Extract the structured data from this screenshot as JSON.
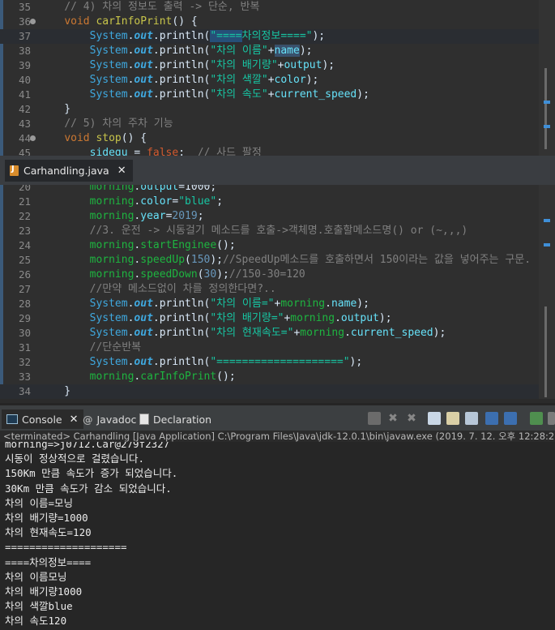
{
  "editor_top": {
    "lines": [
      {
        "n": "35",
        "segs": [
          [
            "    ",
            "t-plain"
          ],
          [
            "// 4) 차의 정보도 출력 -> 단순, 반복",
            "t-cmt"
          ]
        ]
      },
      {
        "n": "36",
        "fold": true,
        "segs": [
          [
            "    ",
            "t-plain"
          ],
          [
            "void",
            "t-kw"
          ],
          [
            " ",
            "t-plain"
          ],
          [
            "carInfoPrint",
            "t-fn"
          ],
          [
            "() {",
            "t-plain"
          ]
        ]
      },
      {
        "n": "37",
        "hl": true,
        "segs": [
          [
            "        ",
            "t-plain"
          ],
          [
            "System",
            "t-cls"
          ],
          [
            ".",
            "t-plain"
          ],
          [
            "out",
            "t-field"
          ],
          [
            ".println(",
            "t-plain"
          ],
          [
            "\"====",
            "t-str sel"
          ],
          [
            "차의정보====\"",
            "t-str"
          ],
          [
            ");",
            "t-plain"
          ]
        ]
      },
      {
        "n": "38",
        "segs": [
          [
            "        ",
            "t-plain"
          ],
          [
            "System",
            "t-cls"
          ],
          [
            ".",
            "t-plain"
          ],
          [
            "out",
            "t-field"
          ],
          [
            ".println(",
            "t-plain"
          ],
          [
            "\"차의 이름\"",
            "t-str"
          ],
          [
            "+",
            "t-plain"
          ],
          [
            "name",
            "t-var selw"
          ],
          [
            ");",
            "t-plain"
          ]
        ]
      },
      {
        "n": "39",
        "segs": [
          [
            "        ",
            "t-plain"
          ],
          [
            "System",
            "t-cls"
          ],
          [
            ".",
            "t-plain"
          ],
          [
            "out",
            "t-field"
          ],
          [
            ".println(",
            "t-plain"
          ],
          [
            "\"차의 배기량\"",
            "t-str"
          ],
          [
            "+",
            "t-plain"
          ],
          [
            "output",
            "t-var"
          ],
          [
            ");",
            "t-plain"
          ]
        ]
      },
      {
        "n": "40",
        "segs": [
          [
            "        ",
            "t-plain"
          ],
          [
            "System",
            "t-cls"
          ],
          [
            ".",
            "t-plain"
          ],
          [
            "out",
            "t-field"
          ],
          [
            ".println(",
            "t-plain"
          ],
          [
            "\"차의 색깔\"",
            "t-str"
          ],
          [
            "+",
            "t-plain"
          ],
          [
            "color",
            "t-var"
          ],
          [
            ");",
            "t-plain"
          ]
        ]
      },
      {
        "n": "41",
        "segs": [
          [
            "        ",
            "t-plain"
          ],
          [
            "System",
            "t-cls"
          ],
          [
            ".",
            "t-plain"
          ],
          [
            "out",
            "t-field"
          ],
          [
            ".println(",
            "t-plain"
          ],
          [
            "\"차의 속도\"",
            "t-str"
          ],
          [
            "+",
            "t-plain"
          ],
          [
            "current_speed",
            "t-var"
          ],
          [
            ");",
            "t-plain"
          ]
        ]
      },
      {
        "n": "42",
        "segs": [
          [
            "    }",
            "t-plain"
          ]
        ]
      },
      {
        "n": "43",
        "segs": [
          [
            "    ",
            "t-plain"
          ],
          [
            "// 5) 차의 주차 기능",
            "t-cmt"
          ]
        ]
      },
      {
        "n": "44",
        "fold": true,
        "segs": [
          [
            "    ",
            "t-plain"
          ],
          [
            "void",
            "t-kw"
          ],
          [
            " ",
            "t-plain"
          ],
          [
            "stop",
            "t-fn"
          ],
          [
            "() {",
            "t-plain"
          ]
        ]
      },
      {
        "n": "45",
        "segs": [
          [
            "        ",
            "t-plain"
          ],
          [
            "sidegu",
            "t-var"
          ],
          [
            " = ",
            "t-plain"
          ],
          [
            "false",
            "t-kwp"
          ],
          [
            ";  ",
            "t-plain"
          ],
          [
            "// 사드 팔정",
            "t-cmt"
          ]
        ]
      }
    ]
  },
  "tab": {
    "label": "Carhandling.java"
  },
  "editor_bottom": {
    "lines": [
      {
        "n": "20",
        "segs": [
          [
            "        ",
            "t-plain"
          ],
          [
            "morning",
            "t-method"
          ],
          [
            ".",
            "t-plain"
          ],
          [
            "output",
            "t-var"
          ],
          [
            "=1000;",
            "t-plain"
          ]
        ]
      },
      {
        "n": "21",
        "segs": [
          [
            "        ",
            "t-plain"
          ],
          [
            "morning",
            "t-method"
          ],
          [
            ".",
            "t-plain"
          ],
          [
            "color",
            "t-var"
          ],
          [
            "=",
            "t-plain"
          ],
          [
            "\"blue\"",
            "t-str"
          ],
          [
            ";",
            "t-plain"
          ]
        ]
      },
      {
        "n": "22",
        "segs": [
          [
            "        ",
            "t-plain"
          ],
          [
            "morning",
            "t-method"
          ],
          [
            ".",
            "t-plain"
          ],
          [
            "year",
            "t-var"
          ],
          [
            "=",
            "t-plain"
          ],
          [
            "2019",
            "t-num"
          ],
          [
            ";",
            "t-plain"
          ]
        ]
      },
      {
        "n": "23",
        "segs": [
          [
            "        ",
            "t-plain"
          ],
          [
            "//3. 운전 -> 시동걸기 메소드를 호출->객체명.호출할메소드명() or (~,,,)",
            "t-cmt"
          ]
        ]
      },
      {
        "n": "24",
        "segs": [
          [
            "        ",
            "t-plain"
          ],
          [
            "morning",
            "t-method"
          ],
          [
            ".",
            "t-plain"
          ],
          [
            "startEnginee",
            "t-method"
          ],
          [
            "();",
            "t-plain"
          ]
        ]
      },
      {
        "n": "25",
        "segs": [
          [
            "        ",
            "t-plain"
          ],
          [
            "morning",
            "t-method"
          ],
          [
            ".",
            "t-plain"
          ],
          [
            "speedUp",
            "t-method"
          ],
          [
            "(",
            "t-plain"
          ],
          [
            "150",
            "t-num"
          ],
          [
            ");",
            "t-plain"
          ],
          [
            "//SpeedUp메소드를 호출하면서 150이라는 값을 넣어주는 구문.",
            "t-cmt"
          ]
        ]
      },
      {
        "n": "26",
        "segs": [
          [
            "        ",
            "t-plain"
          ],
          [
            "morning",
            "t-method"
          ],
          [
            ".",
            "t-plain"
          ],
          [
            "speedDown",
            "t-method"
          ],
          [
            "(",
            "t-plain"
          ],
          [
            "30",
            "t-num"
          ],
          [
            ");",
            "t-plain"
          ],
          [
            "//150-30=120",
            "t-cmt"
          ]
        ]
      },
      {
        "n": "27",
        "segs": [
          [
            "        ",
            "t-plain"
          ],
          [
            "//만약 메소드없이 차를 정의한다면?..",
            "t-cmt"
          ]
        ]
      },
      {
        "n": "28",
        "segs": [
          [
            "        ",
            "t-plain"
          ],
          [
            "System",
            "t-cls"
          ],
          [
            ".",
            "t-plain"
          ],
          [
            "out",
            "t-field"
          ],
          [
            ".println(",
            "t-plain"
          ],
          [
            "\"차의 이름=\"",
            "t-str"
          ],
          [
            "+",
            "t-plain"
          ],
          [
            "morning",
            "t-method"
          ],
          [
            ".",
            "t-plain"
          ],
          [
            "name",
            "t-var"
          ],
          [
            ");",
            "t-plain"
          ]
        ]
      },
      {
        "n": "29",
        "segs": [
          [
            "        ",
            "t-plain"
          ],
          [
            "System",
            "t-cls"
          ],
          [
            ".",
            "t-plain"
          ],
          [
            "out",
            "t-field"
          ],
          [
            ".println(",
            "t-plain"
          ],
          [
            "\"차의 배기량=\"",
            "t-str"
          ],
          [
            "+",
            "t-plain"
          ],
          [
            "morning",
            "t-method"
          ],
          [
            ".",
            "t-plain"
          ],
          [
            "output",
            "t-var"
          ],
          [
            ");",
            "t-plain"
          ]
        ]
      },
      {
        "n": "30",
        "segs": [
          [
            "        ",
            "t-plain"
          ],
          [
            "System",
            "t-cls"
          ],
          [
            ".",
            "t-plain"
          ],
          [
            "out",
            "t-field"
          ],
          [
            ".println(",
            "t-plain"
          ],
          [
            "\"차의 현재속도=\"",
            "t-str"
          ],
          [
            "+",
            "t-plain"
          ],
          [
            "morning",
            "t-method"
          ],
          [
            ".",
            "t-plain"
          ],
          [
            "current_speed",
            "t-var"
          ],
          [
            ");",
            "t-plain"
          ]
        ]
      },
      {
        "n": "31",
        "segs": [
          [
            "        ",
            "t-plain"
          ],
          [
            "//단순반복",
            "t-cmt"
          ]
        ]
      },
      {
        "n": "32",
        "segs": [
          [
            "        ",
            "t-plain"
          ],
          [
            "System",
            "t-cls"
          ],
          [
            ".",
            "t-plain"
          ],
          [
            "out",
            "t-field"
          ],
          [
            ".println(",
            "t-plain"
          ],
          [
            "\"====================\"",
            "t-str"
          ],
          [
            ");",
            "t-plain"
          ]
        ]
      },
      {
        "n": "33",
        "segs": [
          [
            "        ",
            "t-plain"
          ],
          [
            "morning",
            "t-method"
          ],
          [
            ".",
            "t-plain"
          ],
          [
            "carInfoPrint",
            "t-method"
          ],
          [
            "();",
            "t-plain"
          ]
        ]
      },
      {
        "n": "34",
        "hl": true,
        "segs": [
          [
            "    }",
            "t-plain"
          ]
        ]
      },
      {
        "n": "35",
        "segs": [
          [
            "}",
            "t-plain"
          ]
        ]
      }
    ]
  },
  "console": {
    "tabs": {
      "console": "Console",
      "javadoc": "Javadoc",
      "declaration": "Declaration"
    },
    "status": "<terminated> Carhandling [Java Application] C:\\Program Files\\Java\\jdk-12.0.1\\bin\\javaw.exe (2019. 7. 12. 오후 12:28:23)",
    "lines": [
      "morning=>j0712.Car@279f2327",
      "시동이 정상적으로 걸렸습니다.",
      "150Km 만큼 속도가 증가 되었습니다.",
      "30Km 만큼 속도가 감소 되었습니다.",
      "차의 이름=모닝",
      "차의 배기량=1000",
      "차의 현재속도=120",
      "====================",
      "====차의정보====",
      "차의 이름모닝",
      "차의 배기량1000",
      "차의 색깔blue",
      "차의 속도120"
    ]
  },
  "colors": {
    "editor_bg": "#2f2f2f",
    "console_bg": "#262626",
    "keyword": "#cc7832",
    "string": "#17c6a3",
    "comment": "#808080"
  }
}
